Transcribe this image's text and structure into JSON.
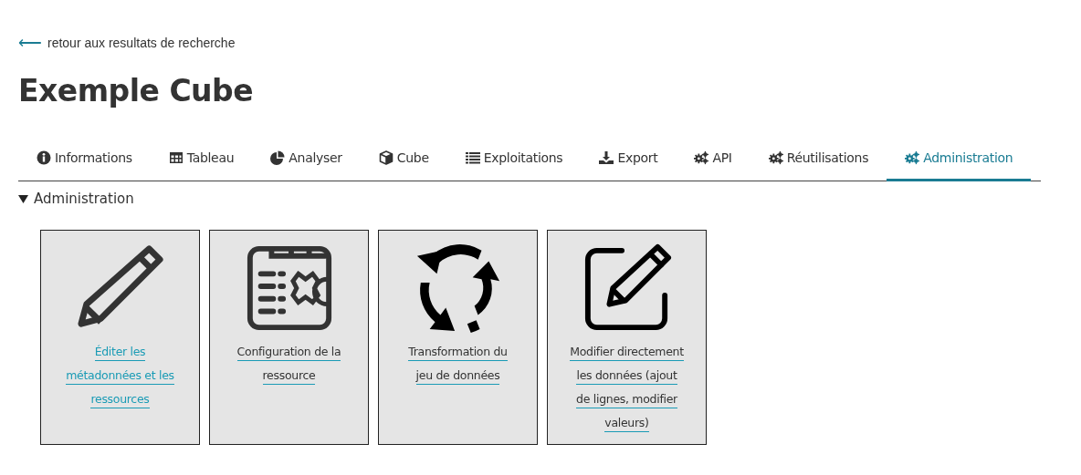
{
  "back_link": {
    "arrow": "⟵",
    "label": "retour aux resultats de recherche"
  },
  "title": "Exemple Cube",
  "tabs": [
    {
      "label": "Informations",
      "kind": "info",
      "selected": false
    },
    {
      "label": "Tableau",
      "kind": "table",
      "selected": false
    },
    {
      "label": "Analyser",
      "kind": "pie",
      "selected": false
    },
    {
      "label": "Cube",
      "kind": "cube",
      "selected": false
    },
    {
      "label": "Exploitations",
      "kind": "list",
      "selected": false
    },
    {
      "label": "Export",
      "kind": "download",
      "selected": false
    },
    {
      "label": "API",
      "kind": "gears",
      "selected": false
    },
    {
      "label": "Réutilisations",
      "kind": "gears",
      "selected": false
    },
    {
      "label": "Administration",
      "kind": "gears",
      "selected": true
    }
  ],
  "section": {
    "title": "Administration",
    "expanded": true
  },
  "cards": [
    {
      "kind": "pencil",
      "lines": [
        "Éditer les",
        "métadonnées et les",
        "ressources"
      ],
      "highlighted": true
    },
    {
      "kind": "config",
      "lines": [
        "Configuration de la",
        "ressource"
      ],
      "highlighted": false
    },
    {
      "kind": "cycle",
      "lines": [
        "Transformation du",
        "jeu de données"
      ],
      "highlighted": false
    },
    {
      "kind": "edit",
      "lines": [
        "Modifier directement",
        "les données (ajout",
        "de lignes, modifier",
        "valeurs)"
      ],
      "highlighted": false
    }
  ]
}
